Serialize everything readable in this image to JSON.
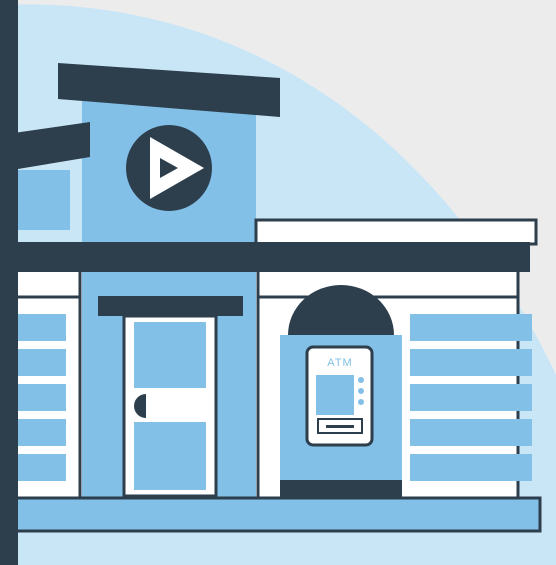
{
  "atm": {
    "label": "ATM"
  },
  "colors": {
    "background": "#ececec",
    "sky": "#c9e6f7",
    "building_blue": "#82c0e8",
    "dark": "#2d3e4c",
    "white": "#ffffff"
  },
  "icons": {
    "logo": "play-triangle-logo-icon",
    "door_handle": "door-handle-icon"
  }
}
